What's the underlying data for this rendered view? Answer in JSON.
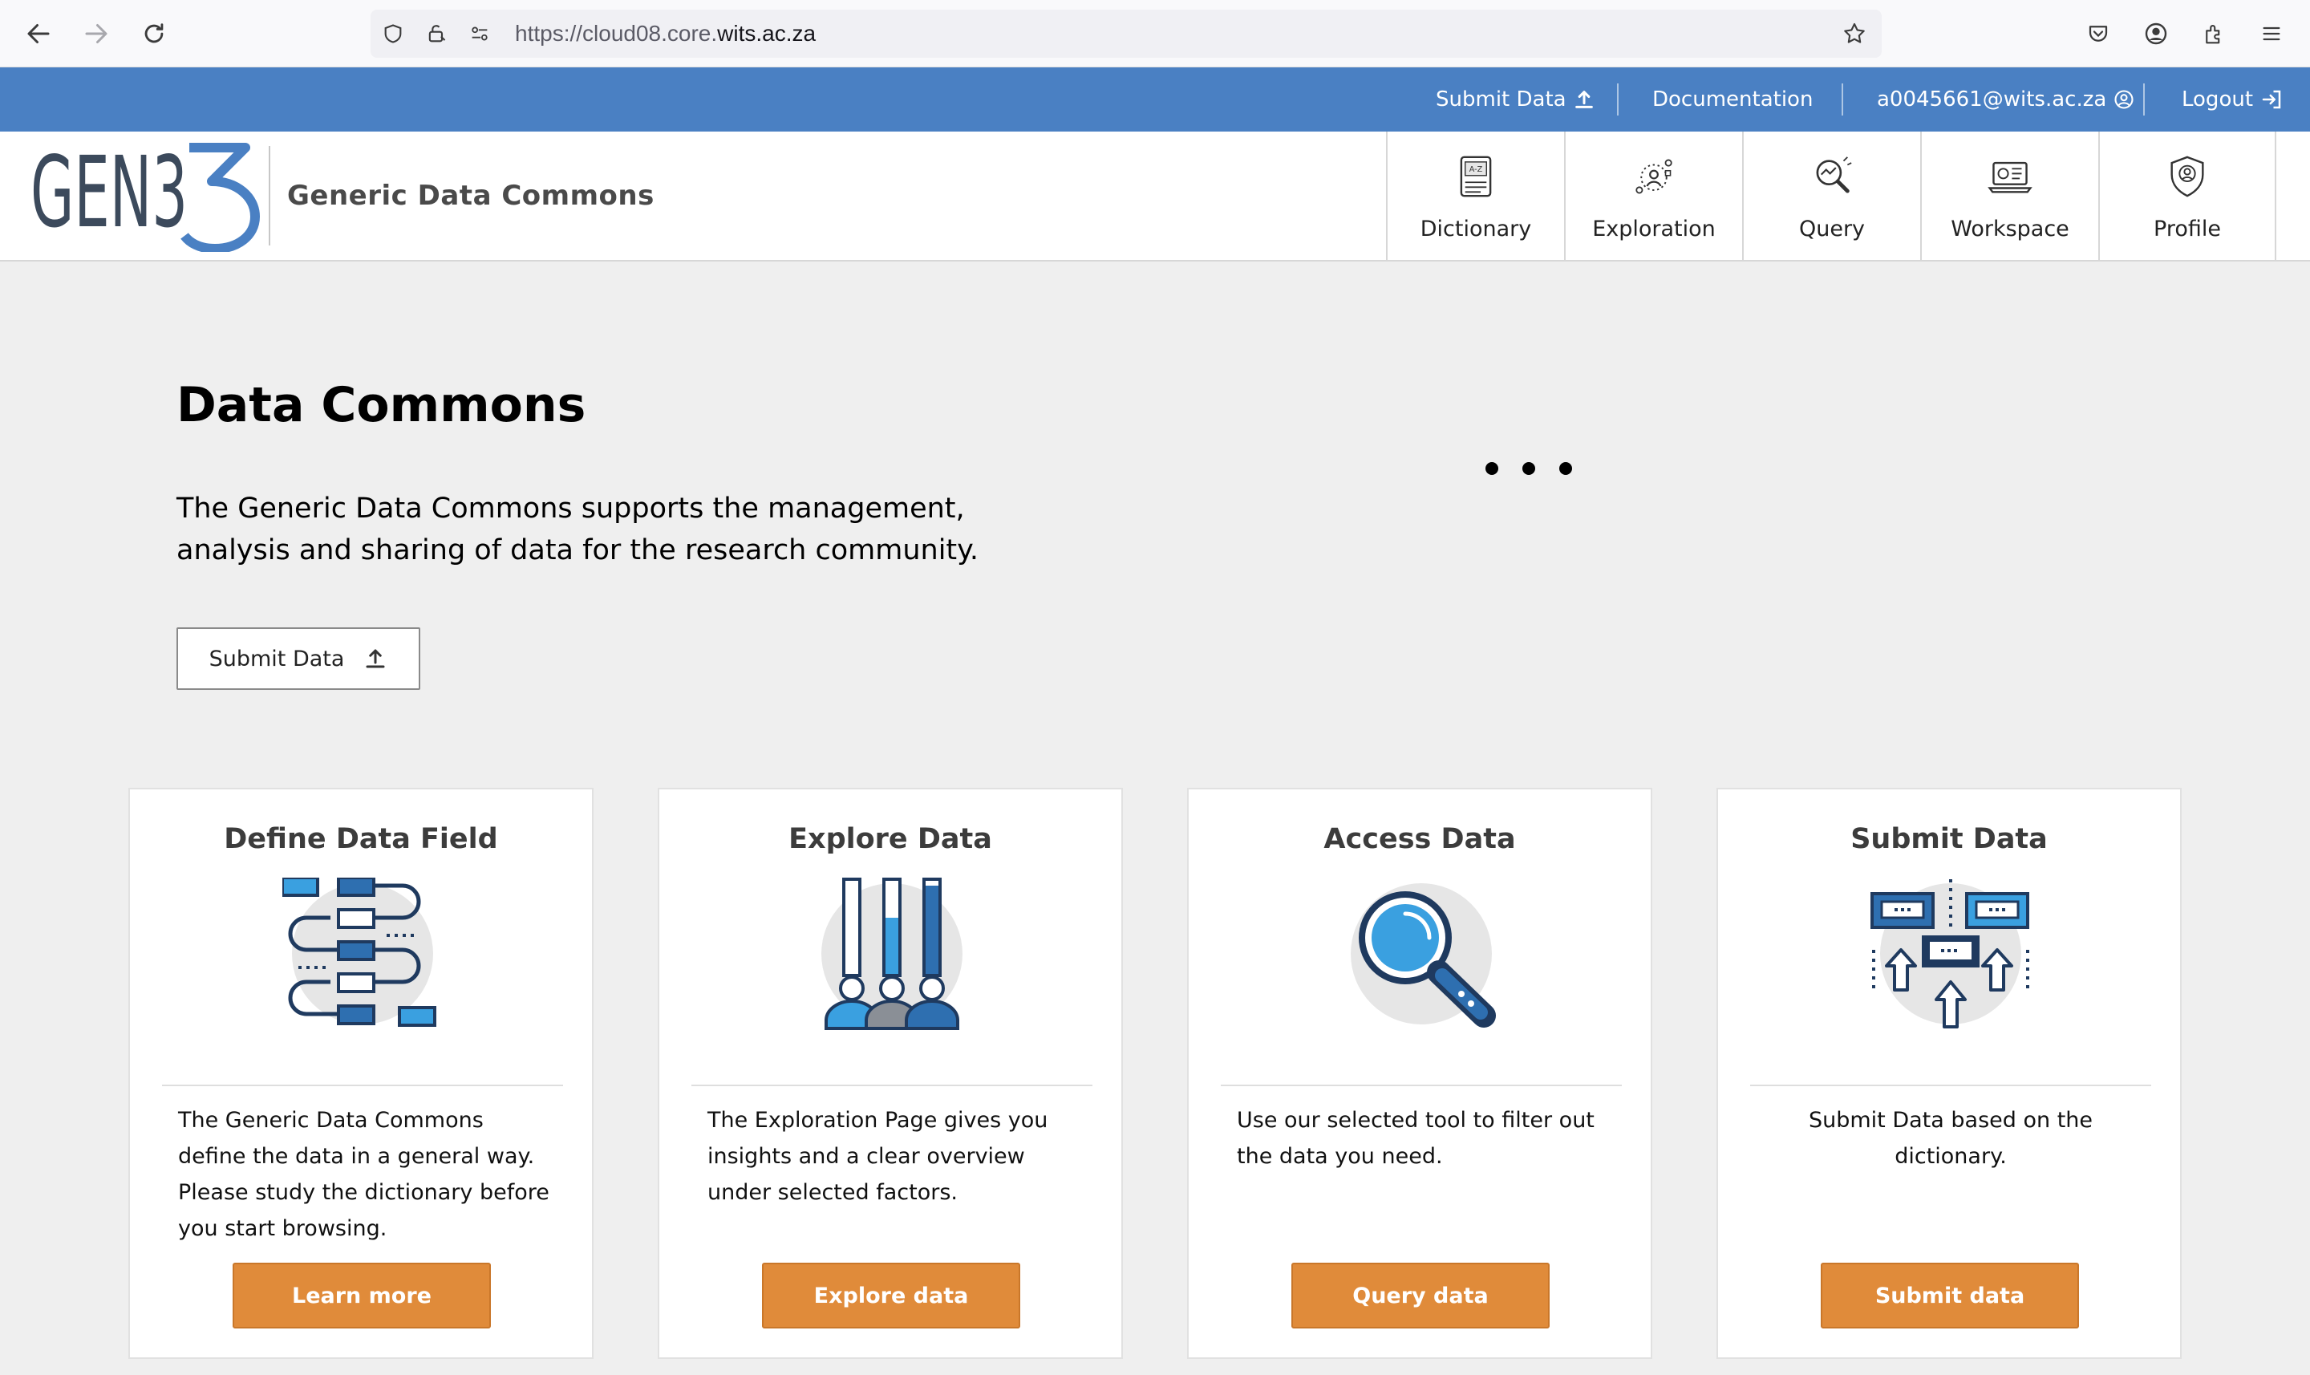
{
  "browser": {
    "url_prefix": "https://cloud08.core.",
    "url_domain": "wits.ac.za",
    "icons": [
      "back-arrow-icon",
      "forward-arrow-icon",
      "reload-icon",
      "shield-icon",
      "lock-icon",
      "permissions-icon",
      "bookmark-star-icon",
      "pocket-icon",
      "account-icon",
      "extensions-icon",
      "menu-icon"
    ]
  },
  "topbar": {
    "submit_data": "Submit Data",
    "documentation": "Documentation",
    "user_email": "a0045661@wits.ac.za",
    "logout": "Logout"
  },
  "header": {
    "logo_text": "GEN3",
    "site_title": "Generic Data Commons",
    "nav": [
      {
        "label": "Dictionary",
        "icon": "dictionary-icon"
      },
      {
        "label": "Exploration",
        "icon": "exploration-icon"
      },
      {
        "label": "Query",
        "icon": "query-icon"
      },
      {
        "label": "Workspace",
        "icon": "workspace-icon"
      },
      {
        "label": "Profile",
        "icon": "profile-icon"
      }
    ]
  },
  "hero": {
    "title": "Data Commons",
    "text_line1": "The Generic Data Commons supports the management,",
    "text_line2": "analysis and sharing of data for the research community.",
    "button": "Submit Data"
  },
  "cards": [
    {
      "title": "Define Data Field",
      "text": "The Generic Data Commons define the data in a general way. Please study the dictionary before you start browsing.",
      "button": "Learn more"
    },
    {
      "title": "Explore Data",
      "text": "The Exploration Page gives you insights and a clear overview under selected factors.",
      "button": "Explore data"
    },
    {
      "title": "Access Data",
      "text": "Use our selected tool to filter out the data you need.",
      "button": "Query data"
    },
    {
      "title": "Submit Data",
      "text": "Submit Data based on the dictionary.",
      "button": "Submit data"
    }
  ],
  "colors": {
    "topbar_blue": "#4a80c3",
    "button_orange": "#e08b3a",
    "logo_blue": "#4a80c3",
    "logo_gray": "#3c4a5c",
    "background": "#efefef"
  }
}
